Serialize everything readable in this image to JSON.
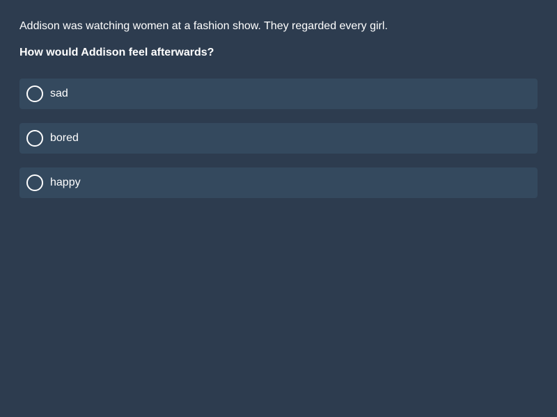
{
  "context": "Addison was watching women at a fashion show. They regarded every girl.",
  "question": "How would Addison feel afterwards?",
  "options": [
    {
      "label": "sad",
      "selected": false
    },
    {
      "label": "bored",
      "selected": false
    },
    {
      "label": "happy",
      "selected": false
    }
  ],
  "colors": {
    "background": "#2d3c4f",
    "option_background": "#34495e",
    "text": "#ffffff"
  }
}
